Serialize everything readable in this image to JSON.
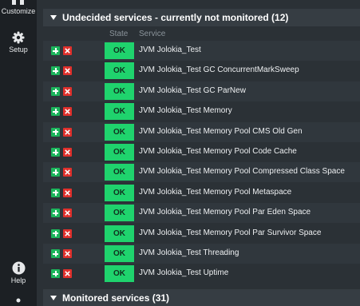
{
  "sidebar": {
    "customize_label": "Customize",
    "setup_label": "Setup",
    "help_label": "Help"
  },
  "groups": {
    "undecided_title": "Undecided services - currently not monitored (12)",
    "monitored_title": "Monitored services (31)"
  },
  "columns": {
    "state": "State",
    "service": "Service"
  },
  "services": [
    {
      "state": "OK",
      "name": "JVM Jolokia_Test"
    },
    {
      "state": "OK",
      "name": "JVM Jolokia_Test GC ConcurrentMarkSweep"
    },
    {
      "state": "OK",
      "name": "JVM Jolokia_Test GC ParNew"
    },
    {
      "state": "OK",
      "name": "JVM Jolokia_Test Memory"
    },
    {
      "state": "OK",
      "name": "JVM Jolokia_Test Memory Pool CMS Old Gen"
    },
    {
      "state": "OK",
      "name": "JVM Jolokia_Test Memory Pool Code Cache"
    },
    {
      "state": "OK",
      "name": "JVM Jolokia_Test Memory Pool Compressed Class Space"
    },
    {
      "state": "OK",
      "name": "JVM Jolokia_Test Memory Pool Metaspace"
    },
    {
      "state": "OK",
      "name": "JVM Jolokia_Test Memory Pool Par Eden Space"
    },
    {
      "state": "OK",
      "name": "JVM Jolokia_Test Memory Pool Par Survivor Space"
    },
    {
      "state": "OK",
      "name": "JVM Jolokia_Test Threading"
    },
    {
      "state": "OK",
      "name": "JVM Jolokia_Test Uptime"
    }
  ],
  "colors": {
    "ok": "#1fd36d",
    "add": "#1cb55c",
    "delete": "#e0302c"
  },
  "icons": {
    "customize": "grid-icon",
    "setup": "gear-icon",
    "help": "info-icon",
    "add": "plus-icon",
    "delete": "x-icon",
    "collapse": "triangle-down-icon"
  }
}
